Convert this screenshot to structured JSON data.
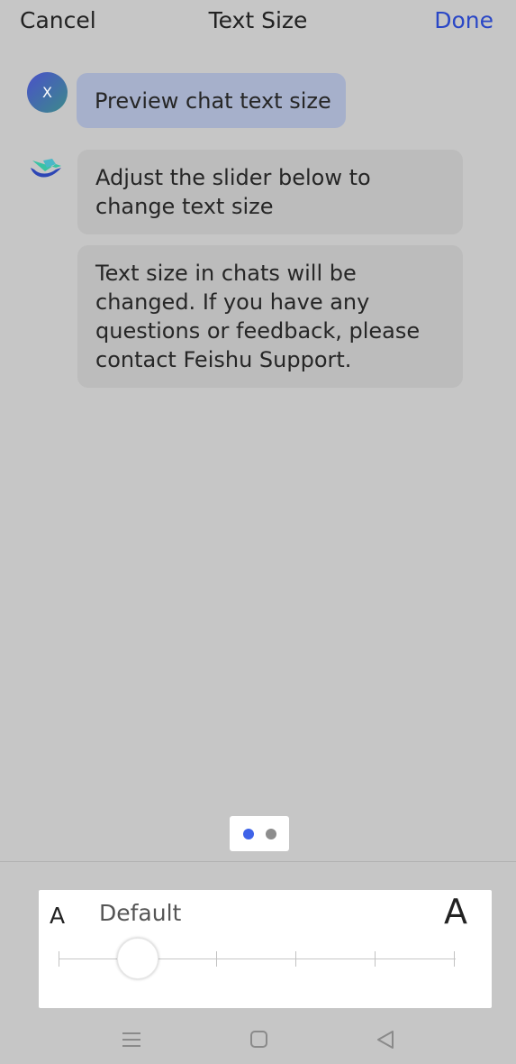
{
  "header": {
    "cancel_label": "Cancel",
    "title": "Text Size",
    "done_label": "Done"
  },
  "chat": {
    "user_avatar_initial": "X",
    "user_message": "Preview chat text size",
    "bot_message_1": "Adjust the slider below to change text size",
    "bot_message_2": "Text size in chats will be changed. If you have any questions or feedback, please contact Feishu Support."
  },
  "pager": {
    "page_count": 2,
    "active_page": 1
  },
  "font_size_panel": {
    "small_label": "A",
    "size_label": "Default",
    "large_label": "A",
    "slider": {
      "steps": 6,
      "selected_step": 2
    }
  },
  "navbar": {
    "icons": [
      "menu-icon",
      "home-icon",
      "back-icon"
    ]
  },
  "colors": {
    "accent": "#2a47c6",
    "page_dot_active": "#3f63e8"
  }
}
